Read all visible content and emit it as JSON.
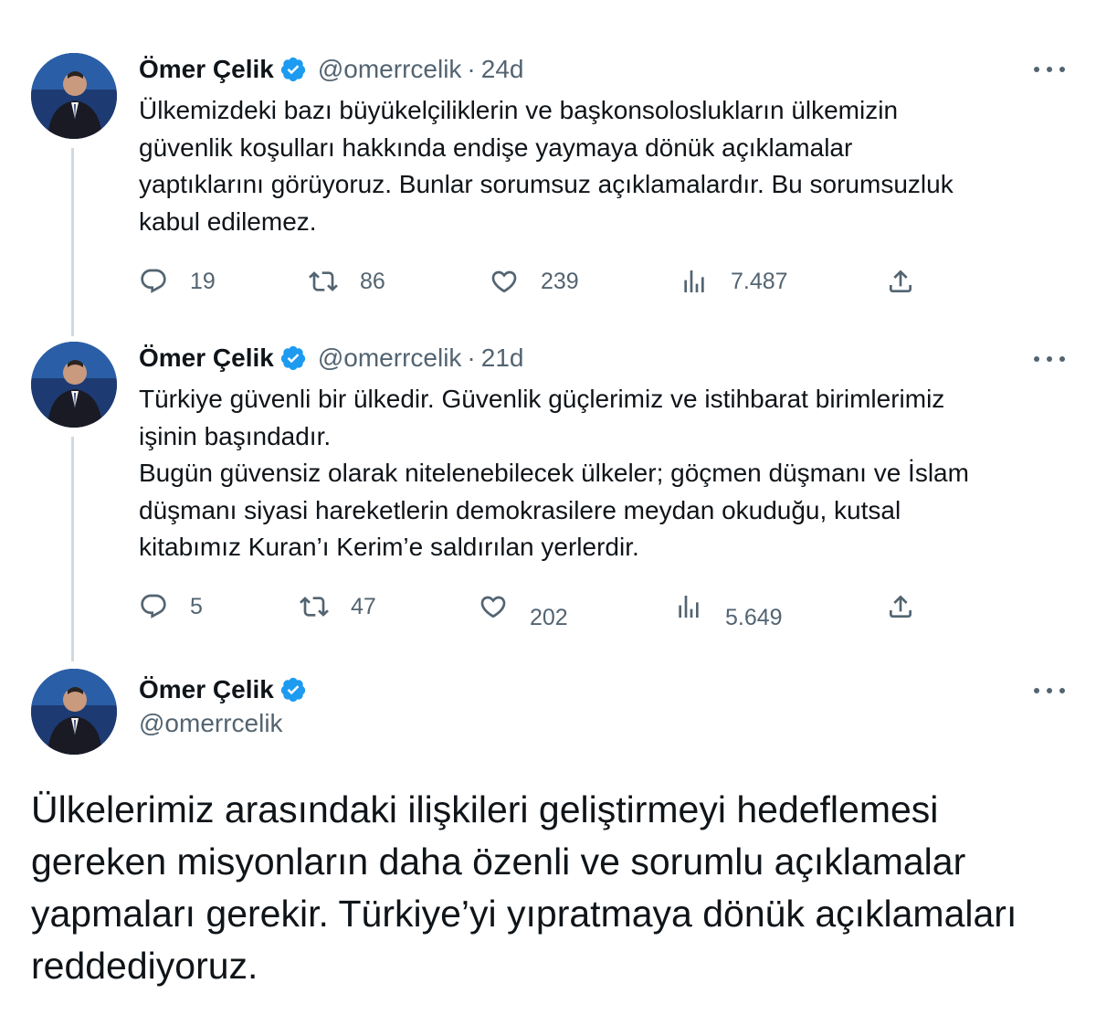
{
  "tweets": [
    {
      "name": "Ömer Çelik",
      "handle": "@omerrcelik",
      "separator": "·",
      "time": "24d",
      "text": "Ülkemizdeki bazı büyükelçiliklerin ve başkonsoloslukların ülkemizin\ngüvenlik koşulları hakkında endişe yaymaya dönük açıklamalar\nyaptıklarını görüyoruz. Bunlar sorumsuz açıklamalardır. Bu sorumsuzluk\nkabul edilemez.",
      "replies": "19",
      "retweets": "86",
      "likes": "239",
      "views": "7.487"
    },
    {
      "name": "Ömer Çelik",
      "handle": "@omerrcelik",
      "separator": "·",
      "time": "21d",
      "text": "Türkiye güvenli bir ülkedir. Güvenlik güçlerimiz ve istihbarat birimlerimiz\nişinin başındadır.\nBugün güvensiz olarak nitelenebilecek ülkeler; göçmen düşmanı ve İslam\ndüşmanı siyasi hareketlerin demokrasilere meydan okuduğu, kutsal\nkitabımız Kuran’ı Kerim’e saldırılan yerlerdir.",
      "replies": "5",
      "retweets": "47",
      "likes": "202",
      "views": "5.649"
    }
  ],
  "main_tweet": {
    "name": "Ömer Çelik",
    "handle": "@omerrcelik",
    "text": "Ülkelerimiz arasındaki ilişkileri geliştirmeyi hedeflemesi gereken misyonların daha özenli ve sorumlu açıklamalar yapmaları gerekir. Türkiye’yi yıpratmaya dönük açıklamaları reddediyoruz."
  },
  "icons": [
    "reply-icon",
    "retweet-icon",
    "like-icon",
    "views-icon",
    "share-icon",
    "verified-badge-icon",
    "more-icon"
  ],
  "colors": {
    "verified": "#1d9bf0",
    "secondary_text": "#536471",
    "thread_line": "#cfd9de"
  }
}
